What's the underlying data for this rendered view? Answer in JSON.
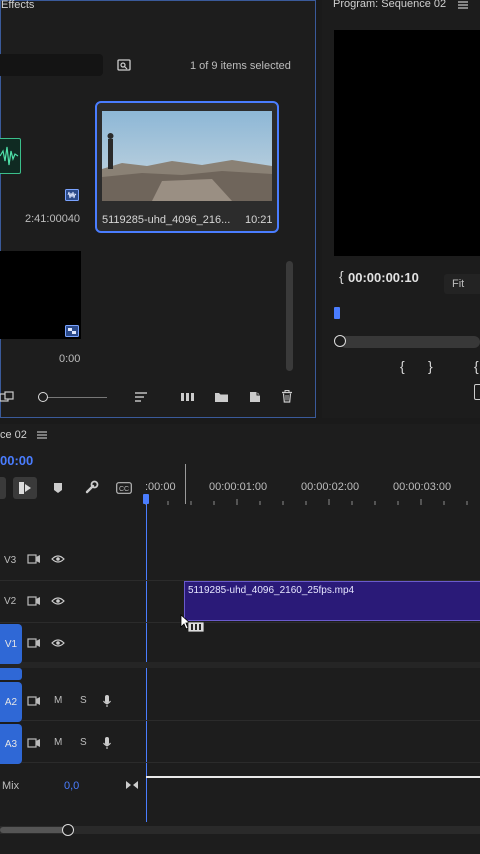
{
  "project_panel": {
    "title_fragment": "Effects",
    "items_selected": "1 of 9 items selected",
    "audio_item_duration": "2:41:00040",
    "video_item_name": "5119285-uhd_4096_216...",
    "video_item_duration": "10:21",
    "black_item_duration": "0:00"
  },
  "program_monitor": {
    "title": "Program: Sequence 02",
    "timecode": "00:00:00:10",
    "fit_label": "Fit"
  },
  "timeline": {
    "tab_label": "ce 02",
    "timecode": "00:00",
    "ruler_labels": [
      ":00:00",
      "00:00:01:00",
      "00:00:02:00",
      "00:00:03:00"
    ],
    "tracks": {
      "v3": "V3",
      "v2": "V2",
      "v1": "V1",
      "a2": "A2",
      "a3": "A3",
      "m": "M",
      "s": "S"
    },
    "mix_label": "Mix",
    "mix_value": "0,0",
    "clip_name": "5119285-uhd_4096_2160_25fps.mp4"
  },
  "colors": {
    "accent_blue": "#2f68d6",
    "clip_purple": "#2a1a78",
    "selection_blue": "#4a7dff"
  }
}
